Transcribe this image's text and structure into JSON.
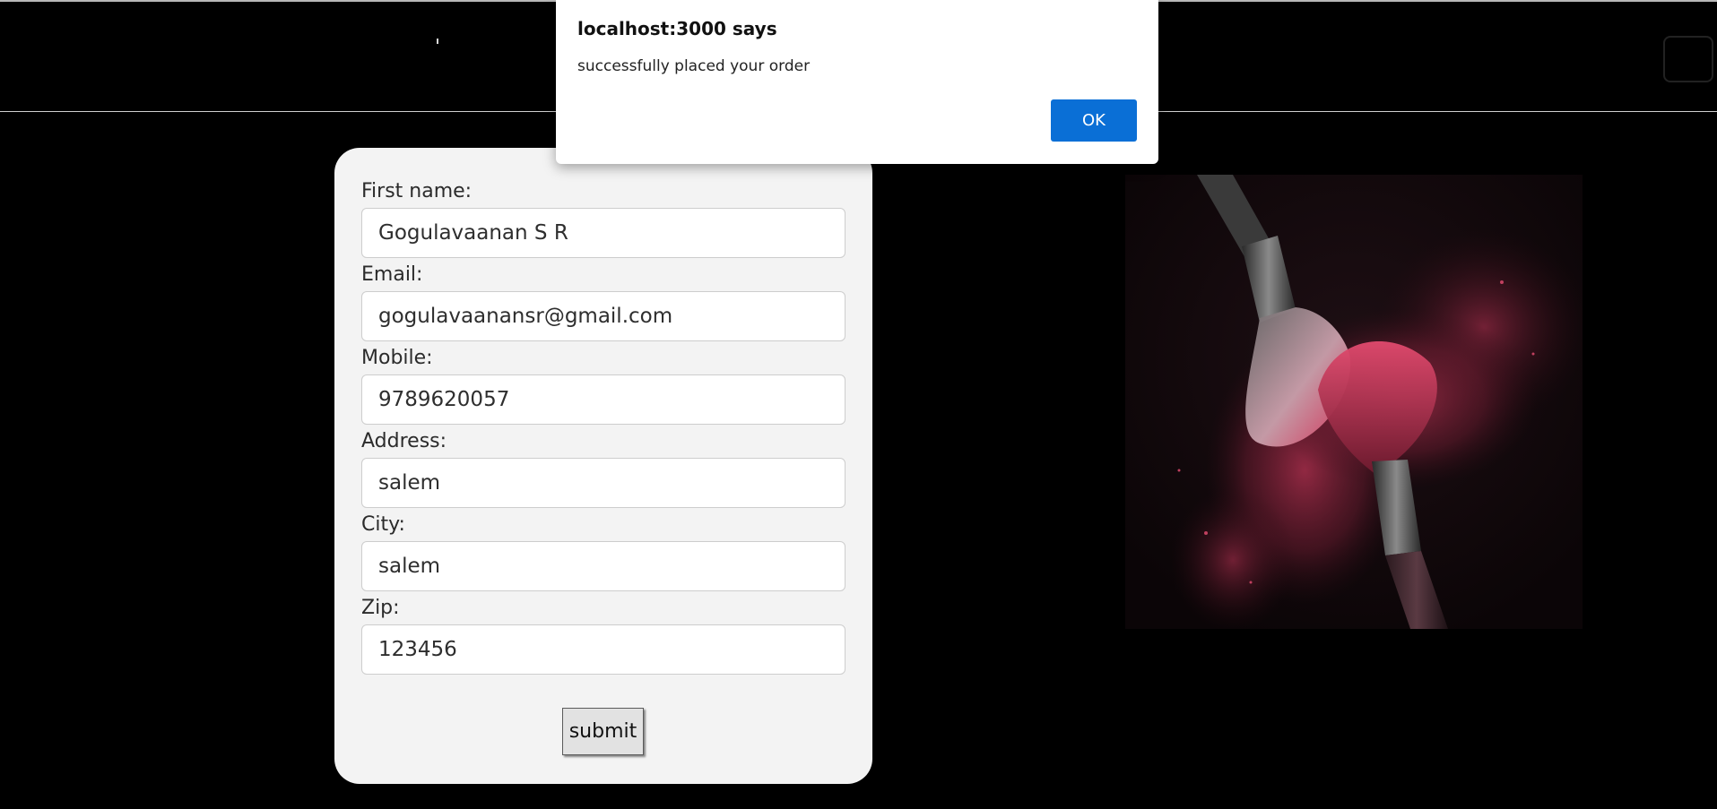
{
  "alert": {
    "title": "localhost:3000 says",
    "message": "successfully placed your order",
    "ok_label": "OK"
  },
  "form": {
    "fields": [
      {
        "label": "First name:",
        "value": "Gogulavaanan S R"
      },
      {
        "label": "Email:",
        "value": "gogulavaanansr@gmail.com"
      },
      {
        "label": "Mobile:",
        "value": "9789620057"
      },
      {
        "label": "Address:",
        "value": "salem"
      },
      {
        "label": "City:",
        "value": "salem"
      },
      {
        "label": "Zip:",
        "value": "123456"
      }
    ],
    "submit_label": "submit"
  },
  "colors": {
    "background": "#000000",
    "card": "#f3f3f3",
    "accent": "#0a6fd6"
  },
  "image": {
    "icon": "makeup-brushes-image"
  }
}
